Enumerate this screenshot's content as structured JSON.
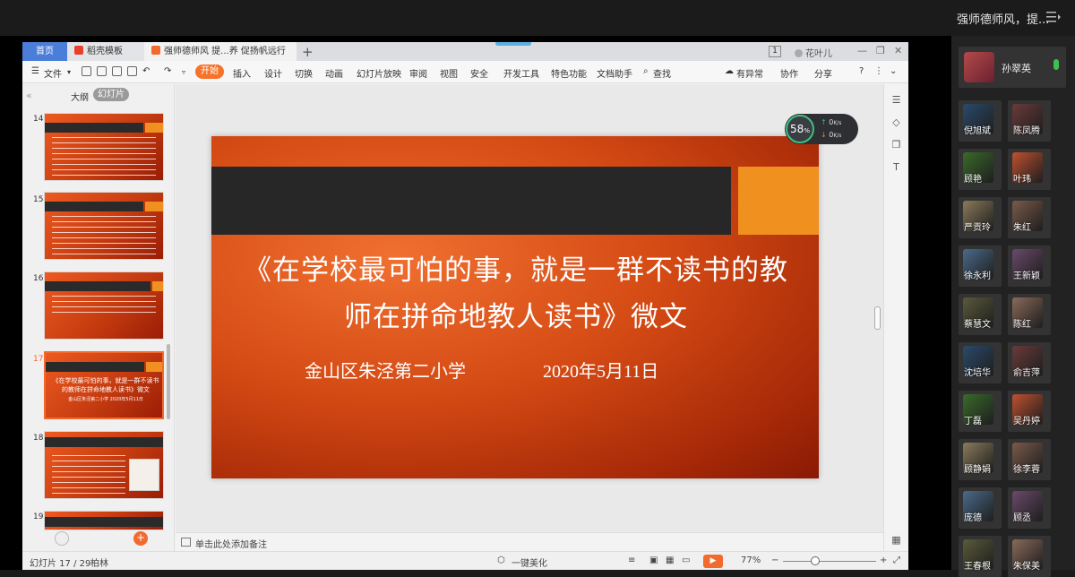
{
  "meeting": {
    "title": "强师德师风，提...",
    "host": "孙翠英",
    "participants": [
      "倪旭斌",
      "陈凤腾",
      "顾艳",
      "叶玮",
      "严贡玲",
      "朱红",
      "徐永利",
      "王新颖",
      "蔡慧文",
      "陈红",
      "沈培华",
      "俞吉萍",
      "丁磊",
      "吴丹婷",
      "顾静娟",
      "徐李蓉",
      "庞德",
      "顾丞",
      "王春根",
      "朱保美"
    ]
  },
  "wps": {
    "tabs": {
      "home": "首页",
      "templates": "稻壳模板",
      "doc": "强师德师风 提...养 促扬帆远行"
    },
    "page_badge": "1",
    "user": "花叶儿",
    "menu": {
      "file": "文件",
      "items": [
        "开始",
        "插入",
        "设计",
        "切换",
        "动画",
        "幻灯片放映",
        "审阅",
        "视图",
        "安全",
        "开发工具",
        "特色功能",
        "文档助手"
      ],
      "search": "查找",
      "changes": "有异常",
      "collab": "协作",
      "share": "分享"
    },
    "panel": {
      "outline_tab": "大纲",
      "slides_tab": "幻灯片",
      "thumbnails": [
        {
          "num": "14"
        },
        {
          "num": "15"
        },
        {
          "num": "16"
        },
        {
          "num": "17",
          "title": "《在学校最可怕的事，就是一群不读书的教师在拼命地教人读书》微文",
          "sub": "金山区朱泾第二小学      2020年5月11日"
        },
        {
          "num": "18"
        },
        {
          "num": "19"
        }
      ]
    },
    "slide": {
      "title": "《在学校最可怕的事，就是一群不读书的教师在拼命地教人读书》微文",
      "school": "金山区朱泾第二小学",
      "date": "2020年5月11日"
    },
    "network": {
      "percent": "58",
      "unit": "%",
      "up": "0",
      "down": "0",
      "speed_unit": "K/s"
    },
    "notes_placeholder": "单击此处添加备注",
    "status": {
      "slide_counter": "幻灯片 17 / 29",
      "theme": "柏林",
      "beautify": "一键美化",
      "zoom": "77%"
    }
  },
  "colors": {
    "accent": "#f26a2e",
    "slide_band": "#272727",
    "slide_square": "#f0901e",
    "home_tab": "#4a7ed8"
  }
}
